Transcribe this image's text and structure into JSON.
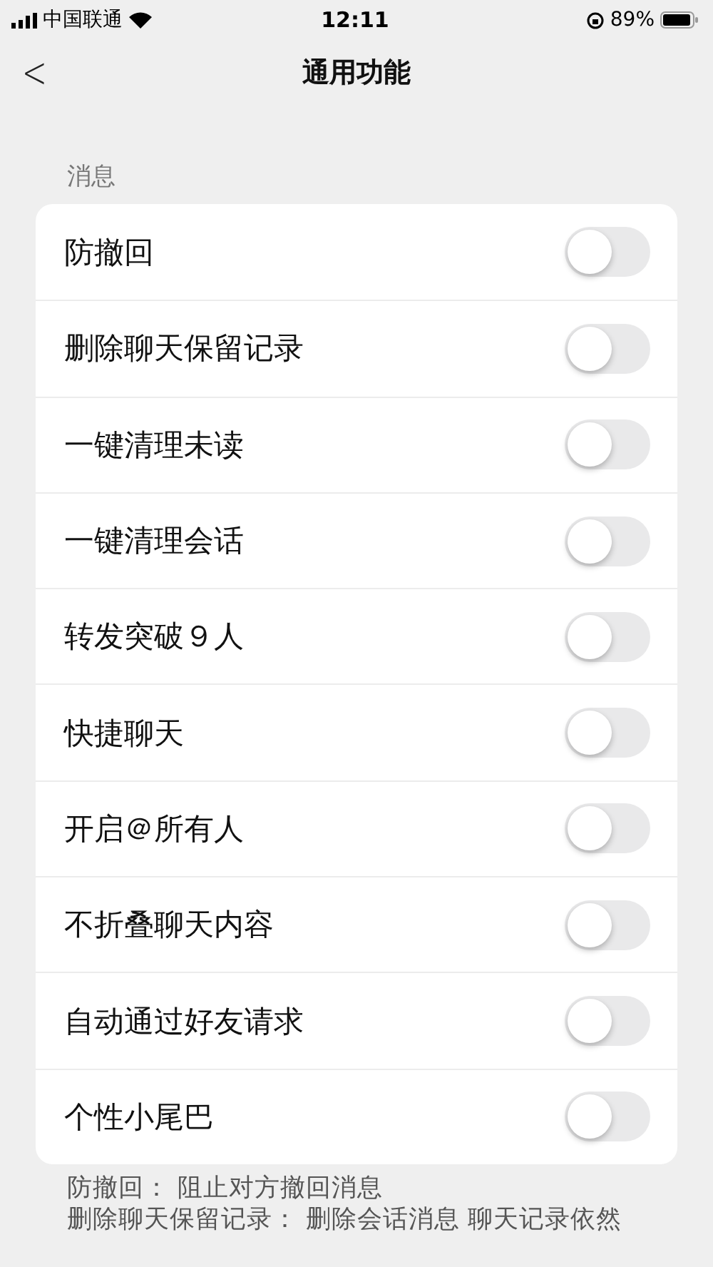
{
  "status_bar": {
    "carrier": "中国联通",
    "time": "12:11",
    "battery": "89%"
  },
  "nav": {
    "back": "<",
    "title": "通用功能"
  },
  "section": {
    "label": "消息",
    "items": [
      {
        "label": "防撤回",
        "on": false
      },
      {
        "label": "删除聊天保留记录",
        "on": false
      },
      {
        "label": "一键清理未读",
        "on": false
      },
      {
        "label": "一键清理会话",
        "on": false
      },
      {
        "label": "转发突破９人",
        "on": false
      },
      {
        "label": "快捷聊天",
        "on": false
      },
      {
        "label": "开启＠所有人",
        "on": false
      },
      {
        "label": "不折叠聊天内容",
        "on": false
      },
      {
        "label": "自动通过好友请求",
        "on": false
      },
      {
        "label": "个性小尾巴",
        "on": false
      }
    ]
  },
  "notes": [
    "防撤回： 阻止对方撤回消息",
    "删除聊天保留记录： 删除会话消息 聊天记录依然"
  ]
}
